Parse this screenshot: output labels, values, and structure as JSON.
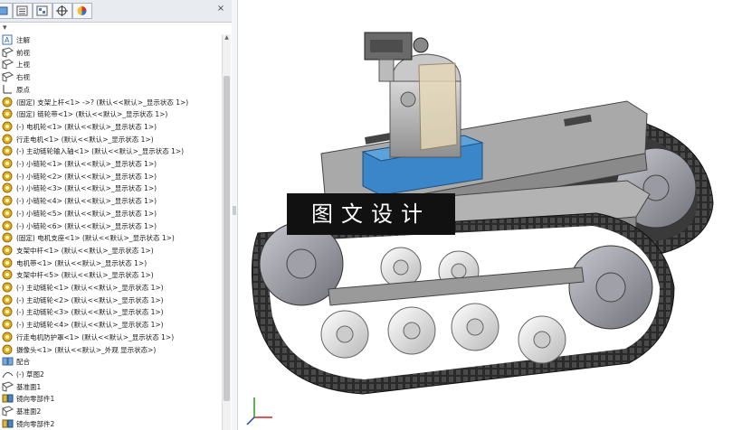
{
  "feature_tree": {
    "items": [
      {
        "icon": "annotation-icon",
        "label": "注解"
      },
      {
        "icon": "plane-icon",
        "label": "前视"
      },
      {
        "icon": "plane-icon",
        "label": "上视"
      },
      {
        "icon": "plane-icon",
        "label": "右视"
      },
      {
        "icon": "origin-icon",
        "label": "原点"
      },
      {
        "icon": "part-icon",
        "label": "(固定) 支架上杆<1> ->? (默认<<默认>_显示状态 1>)"
      },
      {
        "icon": "part-icon",
        "label": "(固定) 链轮带<1> (默认<<默认>_显示状态 1>)"
      },
      {
        "icon": "part-icon",
        "label": "(-) 电机轮<1> (默认<<默认>_显示状态 1>)"
      },
      {
        "icon": "part-icon",
        "label": "行走电机<1> (默认<<默认>_显示状态 1>)"
      },
      {
        "icon": "part-icon",
        "label": "(-) 主动链轮输入轴<1> (默认<<默认>_显示状态 1>)"
      },
      {
        "icon": "part-icon",
        "label": "(-) 小链轮<1> (默认<<默认>_显示状态 1>)"
      },
      {
        "icon": "part-icon",
        "label": "(-) 小链轮<2> (默认<<默认>_显示状态 1>)"
      },
      {
        "icon": "part-icon",
        "label": "(-) 小链轮<3> (默认<<默认>_显示状态 1>)"
      },
      {
        "icon": "part-icon",
        "label": "(-) 小链轮<4> (默认<<默认>_显示状态 1>)"
      },
      {
        "icon": "part-icon",
        "label": "(-) 小链轮<5> (默认<<默认>_显示状态 1>)"
      },
      {
        "icon": "part-icon",
        "label": "(-) 小链轮<6> (默认<<默认>_显示状态 1>)"
      },
      {
        "icon": "part-icon",
        "label": "(固定) 电机支座<1> (默认<<默认>_显示状态 1>)"
      },
      {
        "icon": "part-icon",
        "label": "支架中杆<1> (默认<<默认>_显示状态 1>)"
      },
      {
        "icon": "part-icon",
        "label": "电机带<1> (默认<<默认>_显示状态 1>)"
      },
      {
        "icon": "part-icon",
        "label": "支架中杆<5> (默认<<默认>_显示状态 1>)"
      },
      {
        "icon": "part-icon",
        "label": "(-) 主动链轮<1> (默认<<默认>_显示状态 1>)"
      },
      {
        "icon": "part-icon",
        "label": "(-) 主动链轮<2> (默认<<默认>_显示状态 1>)"
      },
      {
        "icon": "part-icon",
        "label": "(-) 主动链轮<3> (默认<<默认>_显示状态 1>)"
      },
      {
        "icon": "part-icon",
        "label": "(-) 主动链轮<4> (默认<<默认>_显示状态 1>)"
      },
      {
        "icon": "part-icon",
        "label": "行走电机防护罩<1> (默认<<默认>_显示状态 1>)"
      },
      {
        "icon": "part-icon",
        "label": "摄像头<1> (默认<<默认>_外观 显示状态>)"
      },
      {
        "icon": "mates-icon",
        "label": "配合"
      },
      {
        "icon": "sketch-icon",
        "label": "(-) 草图2"
      },
      {
        "icon": "plane-icon",
        "label": "基准面1"
      },
      {
        "icon": "mirror-icon",
        "label": "镜向零部件1"
      },
      {
        "icon": "plane-icon",
        "label": "基准面2"
      },
      {
        "icon": "mirror-icon",
        "label": "镜向零部件2"
      }
    ]
  },
  "viewport": {
    "watermark": "图文设计"
  },
  "colors": {
    "part_icon": "#e0b020",
    "bracket_blue": "#3a86c8",
    "track_dark": "#262626",
    "frame_gray": "#b9b9b9"
  }
}
